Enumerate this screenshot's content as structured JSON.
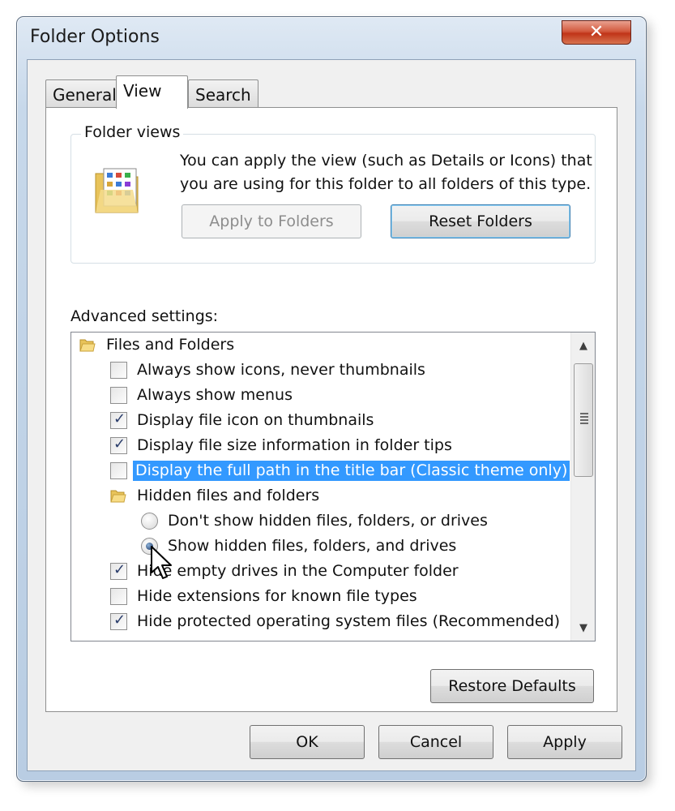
{
  "window": {
    "title": "Folder Options",
    "close_glyph": "✕"
  },
  "tabs": [
    {
      "label": "General",
      "active": false
    },
    {
      "label": "View",
      "active": true
    },
    {
      "label": "Search",
      "active": false
    }
  ],
  "folder_views": {
    "legend": "Folder views",
    "description": "You can apply the view (such as Details or Icons) that you are using for this folder to all folders of this type.",
    "apply_button": "Apply to Folders",
    "reset_button": "Reset Folders",
    "icon": "folder-view-icon"
  },
  "advanced": {
    "label": "Advanced settings:",
    "items": [
      {
        "type": "folder",
        "label": "Files and Folders"
      },
      {
        "type": "checkbox",
        "label": "Always show icons, never thumbnails",
        "checked": false
      },
      {
        "type": "checkbox",
        "label": "Always show menus",
        "checked": false
      },
      {
        "type": "checkbox",
        "label": "Display file icon on thumbnails",
        "checked": true
      },
      {
        "type": "checkbox",
        "label": "Display file size information in folder tips",
        "checked": true
      },
      {
        "type": "checkbox",
        "label": "Display the full path in the title bar (Classic theme only)",
        "checked": false,
        "selected": true
      },
      {
        "type": "folder",
        "label": "Hidden files and folders"
      },
      {
        "type": "radio",
        "label": "Don't show hidden files, folders, or drives",
        "checked": false
      },
      {
        "type": "radio",
        "label": "Show hidden files, folders, and drives",
        "checked": true
      },
      {
        "type": "checkbox",
        "label": "Hide empty drives in the Computer folder",
        "checked": true
      },
      {
        "type": "checkbox",
        "label": "Hide extensions for known file types",
        "checked": false
      },
      {
        "type": "checkbox",
        "label": "Hide protected operating system files (Recommended)",
        "checked": true
      }
    ],
    "restore_button": "Restore Defaults"
  },
  "footer": {
    "ok": "OK",
    "cancel": "Cancel",
    "apply": "Apply"
  },
  "colors": {
    "selection": "#3399ff",
    "close_button": "#c7442a"
  }
}
